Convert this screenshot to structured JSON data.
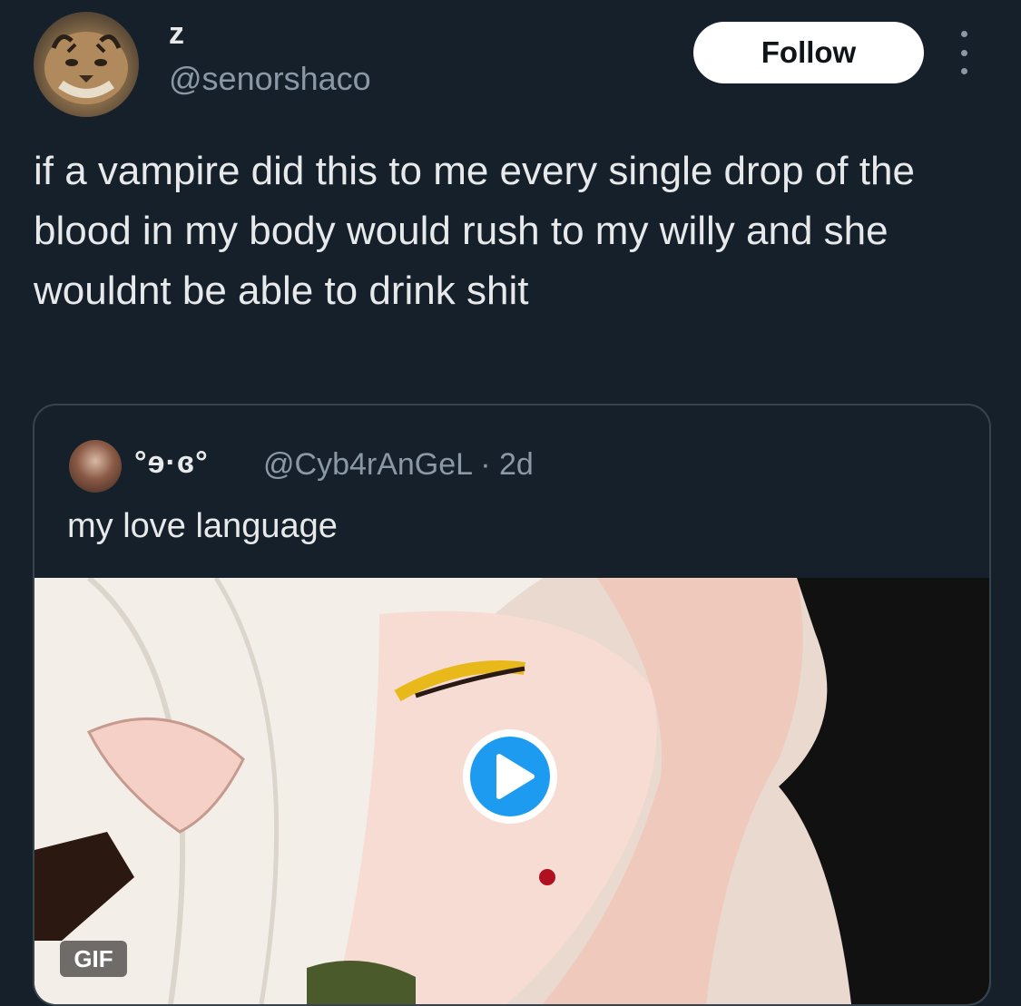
{
  "author": {
    "display_name": "z",
    "handle": "@senorshaco",
    "avatar_icon": "tiger-avatar"
  },
  "follow_label": "Follow",
  "more_icon": "more-vertical-icon",
  "tweet_text": "if a vampire did this to me every single drop of the blood in my body would rush to my willy and she wouldnt be able to drink shit",
  "quote": {
    "display_name": "°ɘ·ɞ°",
    "handle_time": "@Cyb4rAnGeL · 2d",
    "text": "my love language",
    "media_badge": "GIF",
    "play_icon": "play-icon"
  },
  "colors": {
    "background": "#15202b",
    "text": "#e7e9ea",
    "secondary_text": "#8b98a5",
    "border": "#38444d",
    "play_button": "#1d9bf0",
    "follow_button_bg": "#ffffff"
  }
}
